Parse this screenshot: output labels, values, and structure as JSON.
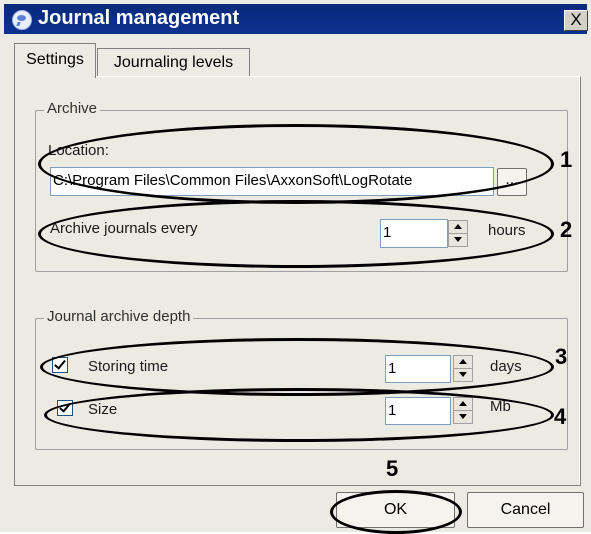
{
  "window": {
    "title": "Journal management",
    "close_symbol": "X"
  },
  "tabs": [
    {
      "label": "Settings",
      "active": true
    },
    {
      "label": "Journaling levels",
      "active": false
    }
  ],
  "archive": {
    "group_label": "Archive",
    "location_label": "Location:",
    "location_value": "C:\\Program Files\\Common Files\\AxxonSoft\\LogRotate",
    "browse_label": "...",
    "every_label": "Archive journals every",
    "every_value": "1",
    "every_unit": "hours"
  },
  "depth": {
    "group_label": "Journal archive depth",
    "storing_time_label": "Storing time",
    "storing_time_checked": true,
    "storing_time_value": "1",
    "storing_time_unit": "days",
    "size_label": "Size",
    "size_checked": true,
    "size_value": "1",
    "size_unit": "Mb"
  },
  "buttons": {
    "ok": "OK",
    "cancel": "Cancel"
  },
  "annotations": [
    "1",
    "2",
    "3",
    "4",
    "5"
  ]
}
